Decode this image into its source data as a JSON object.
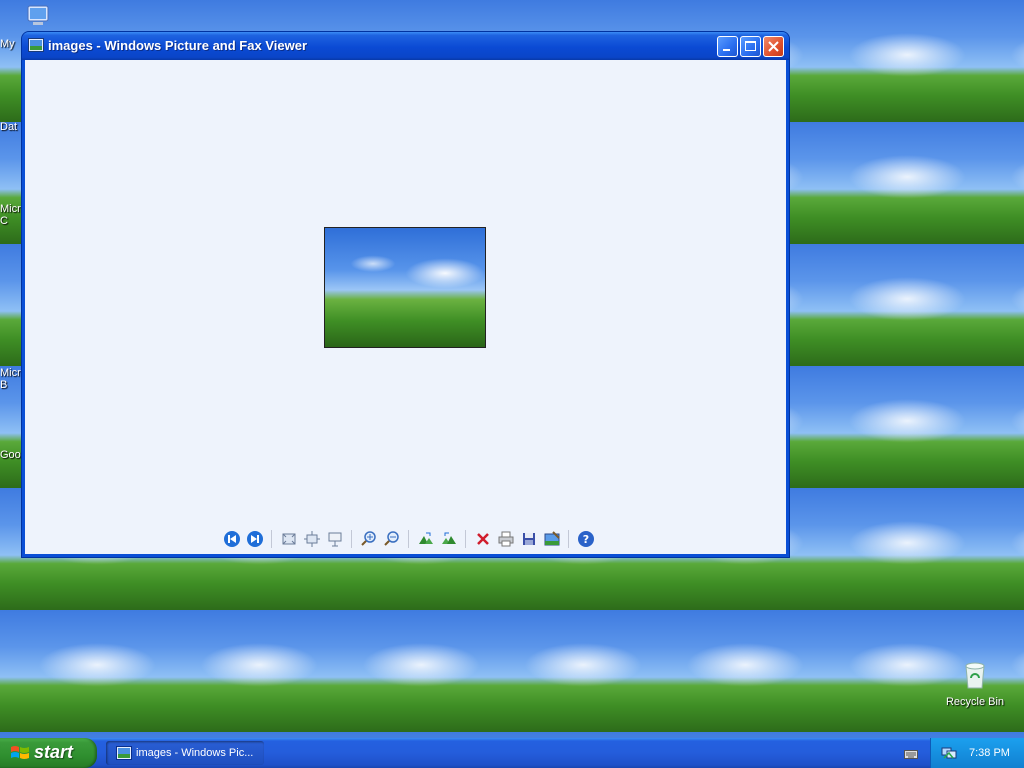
{
  "window": {
    "title": "images - Windows Picture and Fax Viewer",
    "controls": [
      "minimize",
      "maximize",
      "close"
    ]
  },
  "toolbar": {
    "buttons": [
      "previous-image",
      "next-image",
      "best-fit",
      "actual-size",
      "slide-show",
      "zoom-in",
      "zoom-out",
      "rotate-clockwise",
      "rotate-counterclockwise",
      "delete",
      "print",
      "copy-to",
      "open-with",
      "help"
    ]
  },
  "desktop": {
    "icons": [
      {
        "label": "My",
        "semantic": "my-computer"
      },
      {
        "label": "Dat"
      },
      {
        "label": "Micr"
      },
      {
        "label": "C"
      },
      {
        "label": "Micr"
      },
      {
        "label": "B"
      },
      {
        "label": "Goo"
      },
      {
        "label": "Recycle Bin",
        "semantic": "recycle-bin"
      }
    ]
  },
  "taskbar": {
    "start_label": "start",
    "task_label": "images - Windows Pic...",
    "clock": "7:38 PM"
  },
  "colors": {
    "titlebar": "#0a4fd6",
    "client_bg": "#eef3fc",
    "start_green": "#3a9a3a",
    "taskbar_blue": "#245ddb",
    "tray_blue": "#1690e0",
    "close_red": "#e0502c"
  }
}
